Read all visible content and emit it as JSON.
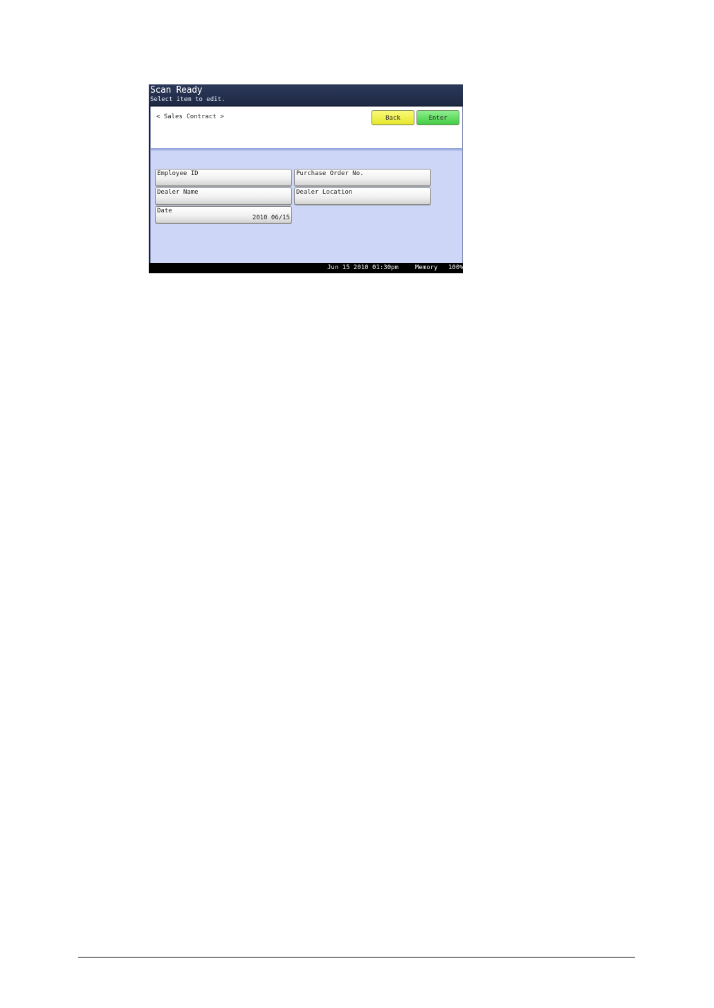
{
  "screen": {
    "title": "Scan Ready",
    "subtitle": "Select item to edit."
  },
  "header": {
    "document_name": "< Sales Contract >",
    "back_label": "Back",
    "enter_label": "Enter",
    "back_color": "#f0f040",
    "enter_color": "#5cd85c"
  },
  "fields": [
    {
      "label": "Employee ID",
      "value": ""
    },
    {
      "label": "Purchase Order No.",
      "value": ""
    },
    {
      "label": "Dealer Name",
      "value": ""
    },
    {
      "label": "Dealer Location",
      "value": ""
    },
    {
      "label": "Date",
      "value": "2010 06/15"
    }
  ],
  "status": {
    "datetime": "Jun 15 2010 01:30pm",
    "memory_label": "Memory",
    "memory_value": "100%"
  }
}
